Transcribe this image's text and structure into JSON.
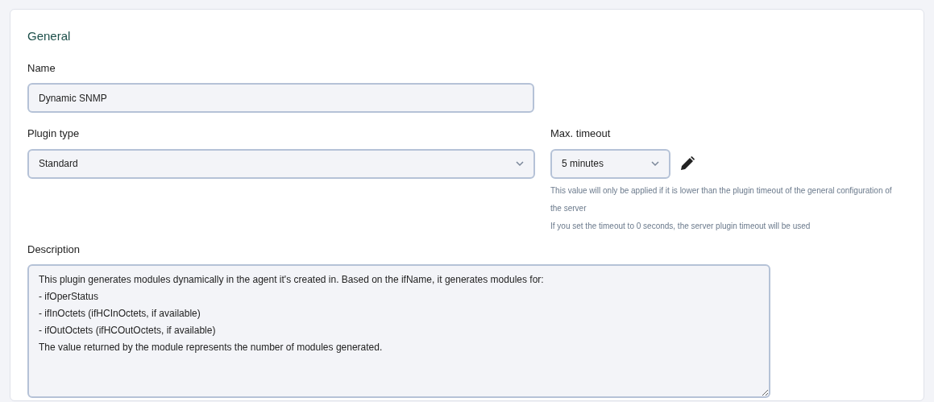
{
  "section_title": "General",
  "name_field": {
    "label": "Name",
    "value": "Dynamic SNMP"
  },
  "plugin_type": {
    "label": "Plugin type",
    "value": "Standard"
  },
  "max_timeout": {
    "label": "Max. timeout",
    "value": "5 minutes",
    "help": [
      "This value will only be applied if it is lower than the plugin timeout of the general configuration of the server",
      "If you set the timeout to 0 seconds, the server plugin timeout will be used"
    ]
  },
  "description": {
    "label": "Description",
    "value": "This plugin generates modules dynamically in the agent it's created in. Based on the ifName, it generates modules for:\n- ifOperStatus\n- ifInOctets (ifHCInOctets, if available)\n- ifOutOctets (ifHCOutOctets, if available)\nThe value returned by the module represents the number of modules generated."
  }
}
